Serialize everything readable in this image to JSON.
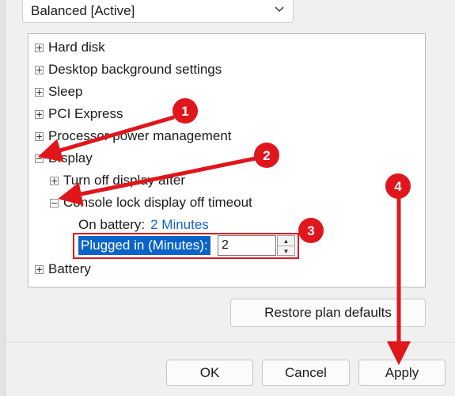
{
  "plan": {
    "selected": "Balanced [Active]"
  },
  "tree": {
    "items": {
      "hard_disk": "Hard disk",
      "desktop_background": "Desktop background settings",
      "sleep": "Sleep",
      "pci_express": "PCI Express",
      "processor_power": "Processor power management",
      "display": "Display",
      "turn_off_display": "Turn off display after",
      "console_lock": "Console lock display off timeout",
      "battery": "Battery"
    },
    "on_battery": {
      "label": "On battery:",
      "value": "2 Minutes"
    },
    "plugged_in": {
      "label": "Plugged in (Minutes):",
      "value": "2"
    }
  },
  "buttons": {
    "restore": "Restore plan defaults",
    "ok": "OK",
    "cancel": "Cancel",
    "apply": "Apply"
  },
  "annotations": {
    "badge_1": "1",
    "badge_2": "2",
    "badge_3": "3",
    "badge_4": "4",
    "color": "#e0161d"
  }
}
